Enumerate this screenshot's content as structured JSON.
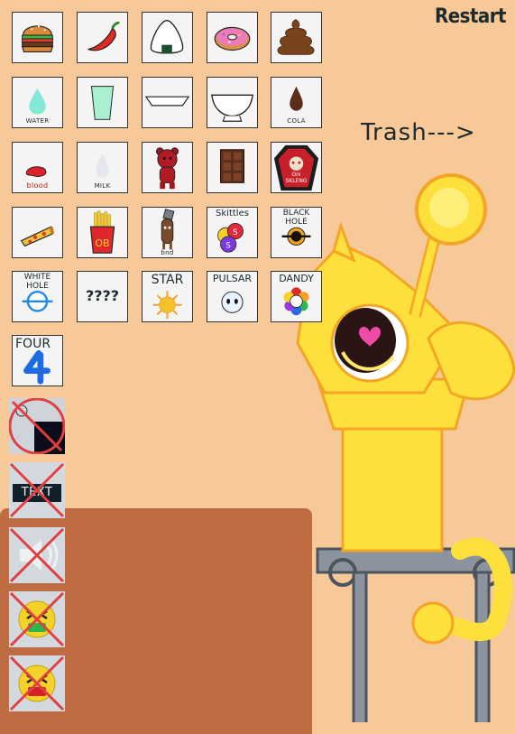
{
  "header": {
    "restart_label": "Restart"
  },
  "trash": {
    "label": "Trash--->"
  },
  "items": [
    {
      "name": "burger",
      "icon": "burger-icon"
    },
    {
      "name": "chili",
      "icon": "chili-pepper-icon"
    },
    {
      "name": "onigiri",
      "icon": "onigiri-icon"
    },
    {
      "name": "donut",
      "icon": "donut-icon"
    },
    {
      "name": "poop",
      "icon": "poop-icon"
    },
    {
      "name": "water",
      "label": "WATER",
      "icon": "water-drop-icon"
    },
    {
      "name": "glass",
      "icon": "glass-icon"
    },
    {
      "name": "tray",
      "icon": "tray-icon"
    },
    {
      "name": "bowl",
      "icon": "bowl-icon"
    },
    {
      "name": "cola",
      "label": "COLA",
      "icon": "cola-drop-icon"
    },
    {
      "name": "blood",
      "label": "blood",
      "icon": "blood-drop-icon"
    },
    {
      "name": "milk",
      "label": "MILK",
      "icon": "milk-drop-icon"
    },
    {
      "name": "bear",
      "icon": "red-bear-icon"
    },
    {
      "name": "chocolate",
      "icon": "chocolate-bar-icon"
    },
    {
      "name": "oni-coffin",
      "label_top": "Oni",
      "label_bottom": "SKLENG",
      "icon": "red-coffin-icon"
    },
    {
      "name": "pizza",
      "icon": "pizza-slice-icon"
    },
    {
      "name": "fries",
      "label": "OB",
      "icon": "fries-icon"
    },
    {
      "name": "figure",
      "label": "bnd",
      "icon": "small-figure-icon"
    },
    {
      "name": "skittles",
      "label": "Skittles",
      "icon": "skittles-icon"
    },
    {
      "name": "black-hole",
      "label": "BLACK HOLE",
      "icon": "black-hole-icon"
    },
    {
      "name": "white-hole",
      "label": "WHITE HOLE",
      "icon": "white-hole-icon"
    },
    {
      "name": "unknown",
      "label": "????",
      "icon": "question-icon"
    },
    {
      "name": "star",
      "label": "STAR",
      "icon": "sun-star-icon"
    },
    {
      "name": "pulsar",
      "label": "PULSAR",
      "icon": "pulsar-face-icon"
    },
    {
      "name": "dandy",
      "label": "DANDY",
      "icon": "flower-icon"
    },
    {
      "name": "four",
      "label": "FOUR",
      "icon": "number-four-icon"
    }
  ],
  "tools": [
    {
      "name": "background-toggle",
      "disabled": true,
      "icon": "background-icon"
    },
    {
      "name": "text-toggle",
      "label": "TEXT",
      "disabled": true,
      "icon": "text-icon"
    },
    {
      "name": "sound-toggle",
      "disabled": true,
      "icon": "speaker-icon"
    },
    {
      "name": "sick-face-green",
      "disabled": true,
      "icon": "sick-face-green-icon"
    },
    {
      "name": "sick-face-red",
      "disabled": true,
      "icon": "sick-face-red-icon"
    }
  ],
  "colors": {
    "background": "#f7c998",
    "table": "#c06c43",
    "creature": "#fde03c",
    "creature_outline": "#f3a526",
    "stand": "#8a939e",
    "disabled_cross": "#e0403f"
  }
}
